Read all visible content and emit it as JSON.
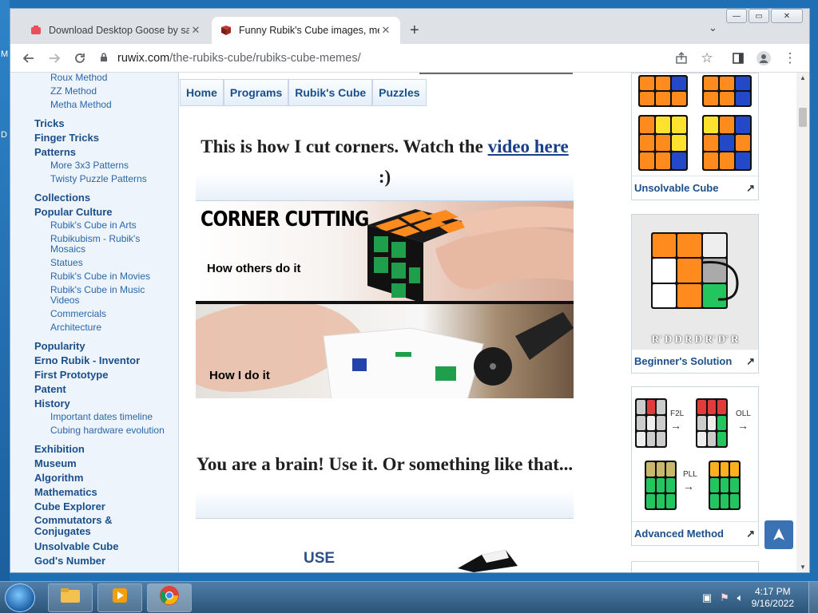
{
  "desktop": {
    "edge_letters": [
      "M",
      "D"
    ]
  },
  "browser": {
    "tabs": [
      {
        "title": "Download Desktop Goose by sa",
        "active": false
      },
      {
        "title": "Funny Rubik's Cube images, mem",
        "active": true
      }
    ],
    "new_tab_symbol": "+",
    "tab_search_symbol": "⌄",
    "window_buttons": {
      "minimize": "—",
      "maximize": "▭",
      "close": "✕"
    },
    "address": {
      "host": "ruwix.com",
      "path": "/the-rubiks-cube/rubiks-cube-memes/"
    },
    "icons": [
      "back-icon",
      "forward-icon",
      "reload-icon",
      "lock-icon",
      "share-icon",
      "bookmark-star-icon",
      "side-panel-icon",
      "profile-icon",
      "menu-icon"
    ]
  },
  "left_nav": {
    "items": [
      {
        "label": "Roux Method",
        "level": 2
      },
      {
        "label": "ZZ Method",
        "level": 2
      },
      {
        "label": "Metha Method",
        "level": 2
      },
      {
        "label": "Tricks",
        "level": 1
      },
      {
        "label": "Finger Tricks",
        "level": 1
      },
      {
        "label": "Patterns",
        "level": 1
      },
      {
        "label": "More 3x3 Patterns",
        "level": 2
      },
      {
        "label": "Twisty Puzzle Patterns",
        "level": 2
      },
      {
        "label": "Collections",
        "level": 1
      },
      {
        "label": "Popular Culture",
        "level": 1
      },
      {
        "label": "Rubik's Cube in Arts",
        "level": 2
      },
      {
        "label": "Rubikubism - Rubik's Mosaics",
        "level": 2
      },
      {
        "label": "Statues",
        "level": 2
      },
      {
        "label": "Rubik's Cube in Movies",
        "level": 2
      },
      {
        "label": "Rubik's Cube in Music Videos",
        "level": 2
      },
      {
        "label": "Commercials",
        "level": 2
      },
      {
        "label": "Architecture",
        "level": 2
      },
      {
        "label": "Popularity",
        "level": 1
      },
      {
        "label": "Erno Rubik - Inventor",
        "level": 1
      },
      {
        "label": "First Prototype",
        "level": 1
      },
      {
        "label": "Patent",
        "level": 1
      },
      {
        "label": "History",
        "level": 1
      },
      {
        "label": "Important dates timeline",
        "level": 2
      },
      {
        "label": "Cubing hardware evolution",
        "level": 2
      },
      {
        "label": "Exhibition",
        "level": 1
      },
      {
        "label": "Museum",
        "level": 1
      },
      {
        "label": "Algorithm",
        "level": 1
      },
      {
        "label": "Mathematics",
        "level": 1
      },
      {
        "label": "Cube Explorer",
        "level": 1
      },
      {
        "label": "Commutators & Conjugates",
        "level": 1
      },
      {
        "label": "Unsolvable Cube",
        "level": 1
      },
      {
        "label": "God's Number",
        "level": 1
      }
    ]
  },
  "top_nav": [
    "Home",
    "Programs",
    "Rubik's Cube",
    "Puzzles"
  ],
  "content": {
    "heading1": {
      "before": "This is how I cut corners. Watch the ",
      "link": "video here",
      "after": " :)"
    },
    "meme": {
      "title": "CORNER CUTTING",
      "caption_top": "How others do it",
      "caption_bottom": "How I do it"
    },
    "heading2": "You are a brain! Use it. Or something like that...",
    "next_image_text": "USE"
  },
  "sidebar_cards": [
    {
      "caption": "Unsolvable Cube"
    },
    {
      "caption": "Beginner's Solution",
      "image_text": "R' D D R D R' D' R"
    },
    {
      "caption": "Advanced Method",
      "image_labels": [
        "F2L",
        "OLL",
        "PLL"
      ]
    }
  ],
  "back_to_top_symbol": "➤",
  "taskbar": {
    "clock_time": "4:17 PM",
    "clock_date": "9/16/2022"
  }
}
